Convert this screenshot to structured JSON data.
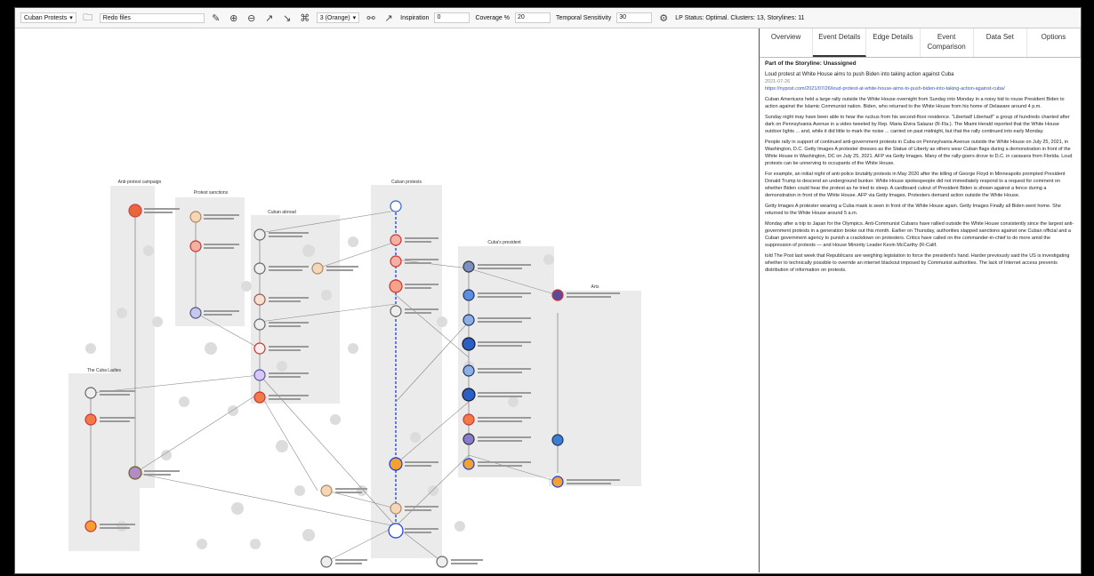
{
  "toolbar": {
    "dataset": "Cuban Protests",
    "file_label": "Redo files",
    "clusters_select": "3 (Orange)",
    "inspiration_label": "Inspiration",
    "inspiration_value": "0",
    "coverage_label": "Coverage %",
    "coverage_value": "20",
    "temporal_label": "Temporal Sensitivity",
    "temporal_value": "30",
    "status": "LP Status: Optimal. Clusters: 13, Storylines: 11"
  },
  "tabs": [
    {
      "label": "Overview"
    },
    {
      "label": "Event Details",
      "active": true
    },
    {
      "label": "Edge Details"
    },
    {
      "label": "Event Comparison"
    },
    {
      "label": "Data Set"
    },
    {
      "label": "Options"
    }
  ],
  "details": {
    "storyline_heading": "Part of the Storyline: Unassigned",
    "title": "Loud protest at White House aims to push Biden into taking action against Cuba",
    "date": "2021-07-26",
    "url": "https://nypost.com/2021/07/26/loud-protest-at-white-house-aims-to-push-biden-into-taking-action-against-cuba/",
    "paragraphs": [
      "Cuban Americans held a large rally outside the White House overnight from Sunday into Monday in a noisy bid to rouse President Biden to action against the Islamic Communist nation. Biden, who returned to the White House from his home of Delaware around 4 p.m.",
      "Sunday night may have been able to hear the ruckus from his second-floor residence. \"Libertad! Libertad!\" a group of hundreds chanted after dark on Pennsylvania Avenue in a video tweeted by Rep. Maria Elvira Salazar (R-Fla.). The Miami Herald reported that the White House outdoor lights ... and, while it did little to mark the noise ... carried on past midnight, but that the rally continued into early Monday.",
      "People rally in support of continued anti-government protests in Cuba on Pennsylvania Avenue outside the White House on July 25, 2021, in Washington, D.C. Getty Images A protester dresses as the Statue of Liberty as others wear Cuban flags during a demonstration in front of the White House in Washington, DC on July 25, 2021. AFP via Getty Images. Many of the rally-goers drove to D.C. in caravans from Florida. Loud protests can be unnerving to occupants of the White House.",
      "For example, an initial night of anti-police brutality protests in May 2020 after the killing of George Floyd in Minneapolis prompted President Donald Trump to descend an underground bunker. White House spokespeople did not immediately respond to a request for comment on whether Biden could hear the protest as he tried to sleep. A cardboard cutout of President Biden is shown against a fence during a demonstration in front of the White House. AFP via Getty Images. Protesters demand action outside the White House.",
      "Getty Images A protester wearing a Cuba mask is seen in front of the White House again. Getty Images Finally all Biden went home. She returned to the White House around 5 a.m.",
      "Monday after a trip to Japan for the Olympics. Anti-Communist Cubans have rallied outside the White House consistently since the largest anti-government protests in a generation broke out this month. Earlier on Thursday, authorities slapped sanctions against one Cuban official and a Cuban government agency to punish a crackdown on protesters. Critics have called on the commander-in-chief to do more amid the suppression of protests — and House Minority Leader Kevin McCarthy (R-Calif.",
      "told The Post last week that Republicans are weighing legislation to force the president's hand. Harder previously said the US is investigating whether to technically possible to override an internet blackout imposed by Communist authorities. The lack of Internet access prevents distribution of information on protests."
    ]
  },
  "graph": {
    "storylines": [
      {
        "title": "Anti-protest campaign"
      },
      {
        "title": "Protest sanctions"
      },
      {
        "title": "Cuban abroad"
      },
      {
        "title": "Cuban protests"
      },
      {
        "title": "Cuba's president"
      },
      {
        "title": "Arts"
      },
      {
        "title": "The Cuba Ladies"
      }
    ]
  }
}
